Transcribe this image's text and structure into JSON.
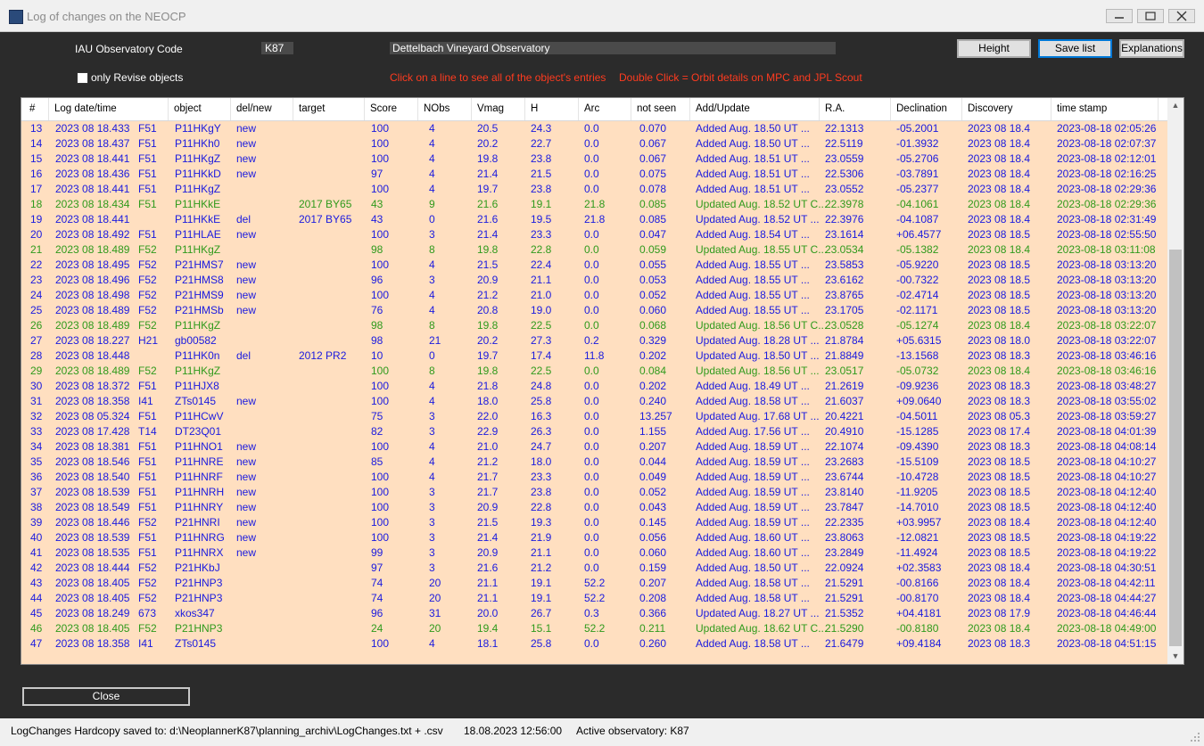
{
  "window": {
    "title": "Log of changes on the NEOCP"
  },
  "form": {
    "iau_label": "IAU Observatory Code",
    "iau_code": "K87",
    "observatory_name": "Dettelbach Vineyard Observatory",
    "revise_label": "only Revise objects",
    "hint_click": "Click on a line to see all of the object's entries",
    "hint_dblclick": "Double Click = Orbit details on MPC and JPL Scout",
    "height_btn": "Height",
    "save_btn": "Save list",
    "explain_btn": "Explanations"
  },
  "table": {
    "columns": [
      "#",
      "Log date/time",
      "object",
      "del/new",
      "target",
      "Score",
      "NObs",
      "Vmag",
      "H",
      "Arc",
      "not seen",
      "Add/Update",
      "R.A.",
      "Declination",
      "Discovery",
      "time stamp"
    ],
    "rows": [
      [
        "13",
        "2023 08 18.433",
        "F51",
        "P11HKgY",
        "new",
        "",
        "100",
        "4",
        "20.5",
        "24.3",
        "0.0",
        "0.070",
        "Added Aug. 18.50 UT      ...",
        "22.1313",
        "-05.2001",
        "2023 08 18.4",
        "2023-08-18  02:05:26"
      ],
      [
        "14",
        "2023 08 18.437",
        "F51",
        "P11HKh0",
        "new",
        "",
        "100",
        "4",
        "20.2",
        "22.7",
        "0.0",
        "0.067",
        "Added Aug. 18.50 UT      ...",
        "22.5119",
        "-01.3932",
        "2023 08 18.4",
        "2023-08-18  02:07:37"
      ],
      [
        "15",
        "2023 08 18.441",
        "F51",
        "P11HKgZ",
        "new",
        "",
        "100",
        "4",
        "19.8",
        "23.8",
        "0.0",
        "0.067",
        "Added Aug. 18.51 UT      ...",
        "23.0559",
        "-05.2706",
        "2023 08 18.4",
        "2023-08-18  02:12:01"
      ],
      [
        "16",
        "2023 08 18.436",
        "F51",
        "P11HKkD",
        "new",
        "",
        "97",
        "4",
        "21.4",
        "21.5",
        "0.0",
        "0.075",
        "Added Aug. 18.51 UT      ...",
        "22.5306",
        "-03.7891",
        "2023 08 18.4",
        "2023-08-18  02:16:25"
      ],
      [
        "17",
        "2023 08 18.441",
        "F51",
        "P11HKgZ",
        "",
        "",
        "100",
        "4",
        "19.7",
        "23.8",
        "0.0",
        "0.078",
        "Added Aug. 18.51 UT      ...",
        "23.0552",
        "-05.2377",
        "2023 08 18.4",
        "2023-08-18  02:29:36"
      ],
      [
        "18",
        "2023 08 18.434",
        "F51",
        "P11HKkE",
        "",
        "2017 BY65",
        "43",
        "9",
        "21.6",
        "19.1",
        "21.8",
        "0.085",
        "Updated Aug. 18.52 UT C...",
        "22.3978",
        "-04.1061",
        "2023 08 18.4",
        "2023-08-18  02:29:36"
      ],
      [
        "19",
        "2023 08 18.441",
        "",
        "P11HKkE",
        "del",
        "2017 BY65",
        "43",
        "0",
        "21.6",
        "19.5",
        "21.8",
        "0.085",
        "Updated Aug. 18.52 UT ...",
        "22.3976",
        "-04.1087",
        "2023 08 18.4",
        "2023-08-18  02:31:49"
      ],
      [
        "20",
        "2023 08 18.492",
        "F51",
        "P11HLAE",
        "new",
        "",
        "100",
        "3",
        "21.4",
        "23.3",
        "0.0",
        "0.047",
        "Added Aug. 18.54 UT      ...",
        "23.1614",
        "+06.4577",
        "2023 08 18.5",
        "2023-08-18  02:55:50"
      ],
      [
        "21",
        "2023 08 18.489",
        "F52",
        "P11HKgZ",
        "",
        "",
        "98",
        "8",
        "19.8",
        "22.8",
        "0.0",
        "0.059",
        "Updated Aug. 18.55 UT C...",
        "23.0534",
        "-05.1382",
        "2023 08 18.4",
        "2023-08-18  03:11:08"
      ],
      [
        "22",
        "2023 08 18.495",
        "F52",
        "P21HMS7",
        "new",
        "",
        "100",
        "4",
        "21.5",
        "22.4",
        "0.0",
        "0.055",
        "Added Aug. 18.55 UT      ...",
        "23.5853",
        "-05.9220",
        "2023 08 18.5",
        "2023-08-18  03:13:20"
      ],
      [
        "23",
        "2023 08 18.496",
        "F52",
        "P21HMS8",
        "new",
        "",
        "96",
        "3",
        "20.9",
        "21.1",
        "0.0",
        "0.053",
        "Added Aug. 18.55 UT      ...",
        "23.6162",
        "-00.7322",
        "2023 08 18.5",
        "2023-08-18  03:13:20"
      ],
      [
        "24",
        "2023 08 18.498",
        "F52",
        "P21HMS9",
        "new",
        "",
        "100",
        "4",
        "21.2",
        "21.0",
        "0.0",
        "0.052",
        "Added Aug. 18.55 UT      ...",
        "23.8765",
        "-02.4714",
        "2023 08 18.5",
        "2023-08-18  03:13:20"
      ],
      [
        "25",
        "2023 08 18.489",
        "F52",
        "P21HMSb",
        "new",
        "",
        "76",
        "4",
        "20.8",
        "19.0",
        "0.0",
        "0.060",
        "Added Aug. 18.55 UT      ...",
        "23.1705",
        "-02.1171",
        "2023 08 18.5",
        "2023-08-18  03:13:20"
      ],
      [
        "26",
        "2023 08 18.489",
        "F52",
        "P11HKgZ",
        "",
        "",
        "98",
        "8",
        "19.8",
        "22.5",
        "0.0",
        "0.068",
        "Updated Aug. 18.56 UT C...",
        "23.0528",
        "-05.1274",
        "2023 08 18.4",
        "2023-08-18  03:22:07"
      ],
      [
        "27",
        "2023 08 18.227",
        "H21",
        "gb00582",
        "",
        "",
        "98",
        "21",
        "20.2",
        "27.3",
        "0.2",
        "0.329",
        "Updated Aug. 18.28 UT   ...",
        "21.8784",
        "+05.6315",
        "2023 08 18.0",
        "2023-08-18  03:22:07"
      ],
      [
        "28",
        "2023 08 18.448",
        "",
        "P11HK0n",
        "del",
        "2012 PR2",
        "10",
        "0",
        "19.7",
        "17.4",
        "11.8",
        "0.202",
        "Updated Aug. 18.50 UT   ...",
        "21.8849",
        "-13.1568",
        "2023 08 18.3",
        "2023-08-18  03:46:16"
      ],
      [
        "29",
        "2023 08 18.489",
        "F52",
        "P11HKgZ",
        "",
        "",
        "100",
        "8",
        "19.8",
        "22.5",
        "0.0",
        "0.084",
        "Updated Aug. 18.56 UT   ...",
        "23.0517",
        "-05.0732",
        "2023 08 18.4",
        "2023-08-18  03:46:16"
      ],
      [
        "30",
        "2023 08 18.372",
        "F51",
        "P11HJX8",
        "",
        "",
        "100",
        "4",
        "21.8",
        "24.8",
        "0.0",
        "0.202",
        "Added Aug. 18.49 UT      ...",
        "21.2619",
        "-09.9236",
        "2023 08 18.3",
        "2023-08-18  03:48:27"
      ],
      [
        "31",
        "2023 08 18.358",
        "I41",
        "ZTs0145",
        "new",
        "",
        "100",
        "4",
        "18.0",
        "25.8",
        "0.0",
        "0.240",
        "Added Aug. 18.58 UT      ...",
        "21.6037",
        "+09.0640",
        "2023 08 18.3",
        "2023-08-18  03:55:02"
      ],
      [
        "32",
        "2023 08 05.324",
        "F51",
        "P11HCwV",
        "",
        "",
        "75",
        "3",
        "22.0",
        "16.3",
        "0.0",
        "13.257",
        "Updated Aug. 17.68 UT   ...",
        "20.4221",
        "-04.5011",
        "2023 08 05.3",
        "2023-08-18  03:59:27"
      ],
      [
        "33",
        "2023 08 17.428",
        "T14",
        "DT23Q01",
        "",
        "",
        "82",
        "3",
        "22.9",
        "26.3",
        "0.0",
        "1.155",
        "Added Aug. 17.56 UT      ...",
        "20.4910",
        "-15.1285",
        "2023 08 17.4",
        "2023-08-18  04:01:39"
      ],
      [
        "34",
        "2023 08 18.381",
        "F51",
        "P11HNO1",
        "new",
        "",
        "100",
        "4",
        "21.0",
        "24.7",
        "0.0",
        "0.207",
        "Added Aug. 18.59 UT      ...",
        "22.1074",
        "-09.4390",
        "2023 08 18.3",
        "2023-08-18  04:08:14"
      ],
      [
        "35",
        "2023 08 18.546",
        "F51",
        "P11HNRE",
        "new",
        "",
        "85",
        "4",
        "21.2",
        "18.0",
        "0.0",
        "0.044",
        "Added Aug. 18.59 UT      ...",
        "23.2683",
        "-15.5109",
        "2023 08 18.5",
        "2023-08-18  04:10:27"
      ],
      [
        "36",
        "2023 08 18.540",
        "F51",
        "P11HNRF",
        "new",
        "",
        "100",
        "4",
        "21.7",
        "23.3",
        "0.0",
        "0.049",
        "Added Aug. 18.59 UT      ...",
        "23.6744",
        "-10.4728",
        "2023 08 18.5",
        "2023-08-18  04:10:27"
      ],
      [
        "37",
        "2023 08 18.539",
        "F51",
        "P11HNRH",
        "new",
        "",
        "100",
        "3",
        "21.7",
        "23.8",
        "0.0",
        "0.052",
        "Added Aug. 18.59 UT      ...",
        "23.8140",
        "-11.9205",
        "2023 08 18.5",
        "2023-08-18  04:12:40"
      ],
      [
        "38",
        "2023 08 18.549",
        "F51",
        "P11HNRY",
        "new",
        "",
        "100",
        "3",
        "20.9",
        "22.8",
        "0.0",
        "0.043",
        "Added Aug. 18.59 UT      ...",
        "23.7847",
        "-14.7010",
        "2023 08 18.5",
        "2023-08-18  04:12:40"
      ],
      [
        "39",
        "2023 08 18.446",
        "F52",
        "P21HNRI",
        "new",
        "",
        "100",
        "3",
        "21.5",
        "19.3",
        "0.0",
        "0.145",
        "Added Aug. 18.59 UT      ...",
        "22.2335",
        "+03.9957",
        "2023 08 18.4",
        "2023-08-18  04:12:40"
      ],
      [
        "40",
        "2023 08 18.539",
        "F51",
        "P11HNRG",
        "new",
        "",
        "100",
        "3",
        "21.4",
        "21.9",
        "0.0",
        "0.056",
        "Added Aug. 18.60 UT      ...",
        "23.8063",
        "-12.0821",
        "2023 08 18.5",
        "2023-08-18  04:19:22"
      ],
      [
        "41",
        "2023 08 18.535",
        "F51",
        "P11HNRX",
        "new",
        "",
        "99",
        "3",
        "20.9",
        "21.1",
        "0.0",
        "0.060",
        "Added Aug. 18.60 UT      ...",
        "23.2849",
        "-11.4924",
        "2023 08 18.5",
        "2023-08-18  04:19:22"
      ],
      [
        "42",
        "2023 08 18.444",
        "F52",
        "P21HKbJ",
        "",
        "",
        "97",
        "3",
        "21.6",
        "21.2",
        "0.0",
        "0.159",
        "Added Aug. 18.50 UT      ...",
        "22.0924",
        "+02.3583",
        "2023 08 18.4",
        "2023-08-18  04:30:51"
      ],
      [
        "43",
        "2023 08 18.405",
        "F52",
        "P21HNP3",
        "",
        "",
        "74",
        "20",
        "21.1",
        "19.1",
        "52.2",
        "0.207",
        "Added Aug. 18.58 UT      ...",
        "21.5291",
        "-00.8166",
        "2023 08 18.4",
        "2023-08-18  04:42:11"
      ],
      [
        "44",
        "2023 08 18.405",
        "F52",
        "P21HNP3",
        "",
        "",
        "74",
        "20",
        "21.1",
        "19.1",
        "52.2",
        "0.208",
        "Added Aug. 18.58 UT      ...",
        "21.5291",
        "-00.8170",
        "2023 08 18.4",
        "2023-08-18  04:44:27"
      ],
      [
        "45",
        "2023 08 18.249",
        "673",
        "xkos347",
        "",
        "",
        "96",
        "31",
        "20.0",
        "26.7",
        "0.3",
        "0.366",
        "Updated Aug. 18.27 UT   ...",
        "21.5352",
        "+04.4181",
        "2023 08 17.9",
        "2023-08-18  04:46:44"
      ],
      [
        "46",
        "2023 08 18.405",
        "F52",
        "P21HNP3",
        "",
        "",
        "24",
        "20",
        "19.4",
        "15.1",
        "52.2",
        "0.211",
        "Updated Aug. 18.62 UT C...",
        "21.5290",
        "-00.8180",
        "2023 08 18.4",
        "2023-08-18  04:49:00"
      ],
      [
        "47",
        "2023 08 18.358",
        "I41",
        "ZTs0145",
        "",
        "",
        "100",
        "4",
        "18.1",
        "25.8",
        "0.0",
        "0.260",
        "Added Aug. 18.58 UT      ...",
        "21.6479",
        "+09.4184",
        "2023 08 18.3",
        "2023-08-18  04:51:15"
      ]
    ],
    "row_colors": [
      "b",
      "b",
      "b",
      "b",
      "b",
      "g",
      "b",
      "b",
      "g",
      "b",
      "b",
      "b",
      "b",
      "g",
      "b",
      "b",
      "g",
      "b",
      "b",
      "b",
      "b",
      "b",
      "b",
      "b",
      "b",
      "b",
      "b",
      "b",
      "b",
      "b",
      "b",
      "b",
      "b",
      "g",
      "b"
    ]
  },
  "colors": {
    "blue": "#1a1adf",
    "green": "#2f9a1c",
    "hint": "#ff3b1f",
    "row_bg": "#ffdfc0"
  },
  "footer": {
    "close_btn": "Close",
    "status_saved": "LogChanges Hardcopy saved to: d:\\NeoplannerK87\\planning_archiv\\LogChanges.txt + .csv",
    "status_time": "18.08.2023 12:56:00",
    "status_observatory": "Active observatory: K87"
  },
  "icons": {
    "minimize": "minimize-icon",
    "maximize": "maximize-icon",
    "close": "close-icon",
    "scroll_up": "scroll-up-icon",
    "scroll_down": "scroll-down-icon",
    "resize_grip": "resize-grip-icon"
  }
}
